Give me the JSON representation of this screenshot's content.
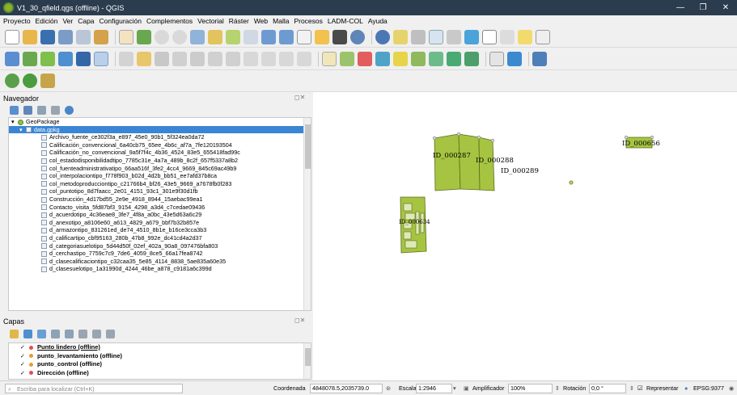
{
  "window": {
    "title": "V1_30_qfield.qgs (offline) - QGIS",
    "controls": [
      "—",
      "❐",
      "✕"
    ]
  },
  "menu": [
    "Proyecto",
    "Edición",
    "Ver",
    "Capa",
    "Configuración",
    "Complementos",
    "Vectorial",
    "Ráster",
    "Web",
    "Malla",
    "Procesos",
    "LADM-COL",
    "Ayuda"
  ],
  "browser": {
    "title": "Navegador",
    "root": "GeoPackage",
    "db": "data.gpkg",
    "tables": [
      "Archivo_fuente_ce302f3a_e897_45e0_90b1_5f324ea0da72",
      "Calificación_convencional_6a40cb75_65ee_4b6c_af7a_7fe120193504",
      "Calificación_no_convencional_9a5f7f4c_4b36_4524_83e5_655418fad99c",
      "col_estadodisponibilidadtipo_7785c31e_4a7a_489b_8c2f_657f5337a8b2",
      "col_fuenteadministrativatipo_66aa516f_3fe2_4cc4_9669_845c69ac49b9",
      "col_interpolaciontipo_f778f903_b02d_4d2b_bb51_ee7afd37b8ca",
      "col_metodoproducciontipo_c21766b4_bf26_43e5_9669_a7678fb0f283",
      "col_puntotipo_8d7faacc_2e01_4151_93c1_301e9f30d1fb",
      "Construcción_4d17bd55_2e9e_4918_8944_15aebac99ea1",
      "Contacto_visita_5fd87bf3_9154_4298_a3d4_c7cedae09436",
      "d_acuerdotipo_4c36eae8_3fe7_4f8a_a0bc_43e5d63a6c29",
      "d_anexotipo_a8106e60_a613_4829_a679_bbf7b32b857e",
      "d_armazontipo_831261ed_de74_4510_8b1e_b16ce3cca3b3",
      "d_calificartipo_cbf95163_280b_47b8_992e_dc41cd4a2d37",
      "d_categoriasuelotipo_5d44d50f_02ef_402a_90a8_097476bfa803",
      "d_cerchastipo_7759c7c9_7de6_4059_8ce5_66a17fea8742",
      "d_clasecalificaciontipo_c32caa35_5e85_4114_8838_5ae835a60e35",
      "d_clasesuelotipo_1a31990d_4244_46be_a878_c9181a6c399d"
    ]
  },
  "layers": {
    "title": "Capas",
    "items": [
      {
        "name": "Punto lindero (offline)",
        "color": "#e05050"
      },
      {
        "name": "punto_levantamiento (offline)",
        "color": "#e0a030"
      },
      {
        "name": "punto_control (offline)",
        "color": "#e0a030"
      },
      {
        "name": "Dirección (offline)",
        "color": "#e05050"
      }
    ]
  },
  "map": {
    "labels": [
      "ID_000287",
      "ID_000288",
      "ID_000289",
      "ID_000656",
      "ID_000634"
    ],
    "fill_color": "#a6c441",
    "stroke_color": "#5a6e1c"
  },
  "status": {
    "locator_placeholder": "Escriba para localizar (Ctrl+K)",
    "coord_label": "Coordenada",
    "coord_value": "4848078.5,2035739.0",
    "scale_label": "Escala",
    "scale_value": "1:2946",
    "magnifier_label": "Amplificador",
    "magnifier_value": "100%",
    "rotation_label": "Rotación",
    "rotation_value": "0,0 °",
    "render_label": "Representar",
    "crs": "EPSG:9377"
  }
}
